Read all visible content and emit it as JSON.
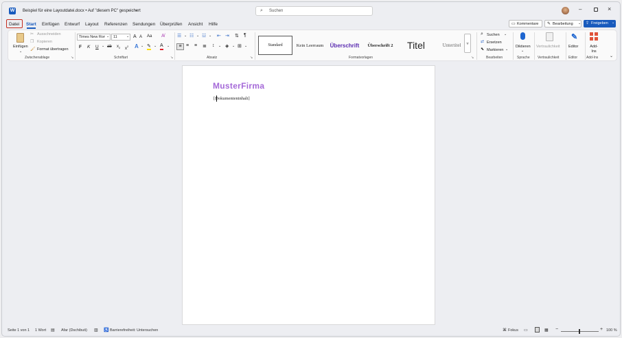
{
  "titlebar": {
    "doc_title": "Beispiel für eine Layoutdatei.docx • Auf \"diesem PC\" gespeichert",
    "search_placeholder": "Suchen",
    "avatar_initial": ""
  },
  "tabs": [
    "Datei",
    "Start",
    "Einfügen",
    "Entwurf",
    "Layout",
    "Referenzen",
    "Sendungen",
    "Überprüfen",
    "Ansicht",
    "Hilfe"
  ],
  "actions": {
    "comments": "Kommentare",
    "editing": "Bearbeitung",
    "share": "Freigeben"
  },
  "clipboard": {
    "paste": "Einfügen",
    "cut": "Ausschneiden",
    "copy": "Kopieren",
    "format_painter": "Format übertragen",
    "label": "Zwischenablage"
  },
  "font": {
    "name": "Times New Roma",
    "size": "11",
    "label": "Schriftart",
    "bold": "F",
    "italic": "K",
    "underline": "U",
    "strike": "ab",
    "sub": "x",
    "sup": "x",
    "grow": "A",
    "shrink": "A",
    "case": "Aa"
  },
  "paragraph": {
    "label": "Absatz"
  },
  "styles": {
    "items": [
      "Standard",
      "Kein Leerraum",
      "Überschrift",
      "Überschrift 2",
      "Titel",
      "Untertitel"
    ],
    "label": "Formatvorlagen"
  },
  "editing": {
    "find": "Suchen",
    "replace": "Ersetzen",
    "select": "Markieren",
    "label": "Bearbeiten"
  },
  "voice": {
    "dictate": "Diktieren",
    "label": "Sprache"
  },
  "sensitivity": {
    "button": "Vertraulichkeit",
    "label": "Vertraulichkeit"
  },
  "editor": {
    "button": "Editor",
    "label": "Editor"
  },
  "addins": {
    "button": "Add-Ins",
    "label": "Add-Ins"
  },
  "document": {
    "brand": "MusterFirma",
    "content": "[Dokumenteninhalt]"
  },
  "status": {
    "page": "Seite 1 von 1",
    "words": "1 Wort",
    "language": "Afar (Dschibuti)",
    "accessibility": "Barrierefreiheit: Untersuchen",
    "focus": "Fokus",
    "zoom": "100 %"
  },
  "colors": {
    "accent": "#185abd",
    "brand": "#a569d8",
    "heading": "#2b3b8f",
    "font_color": "#e0202a",
    "highlight": "#ffe100",
    "selected_outline": "#c42b1c"
  }
}
